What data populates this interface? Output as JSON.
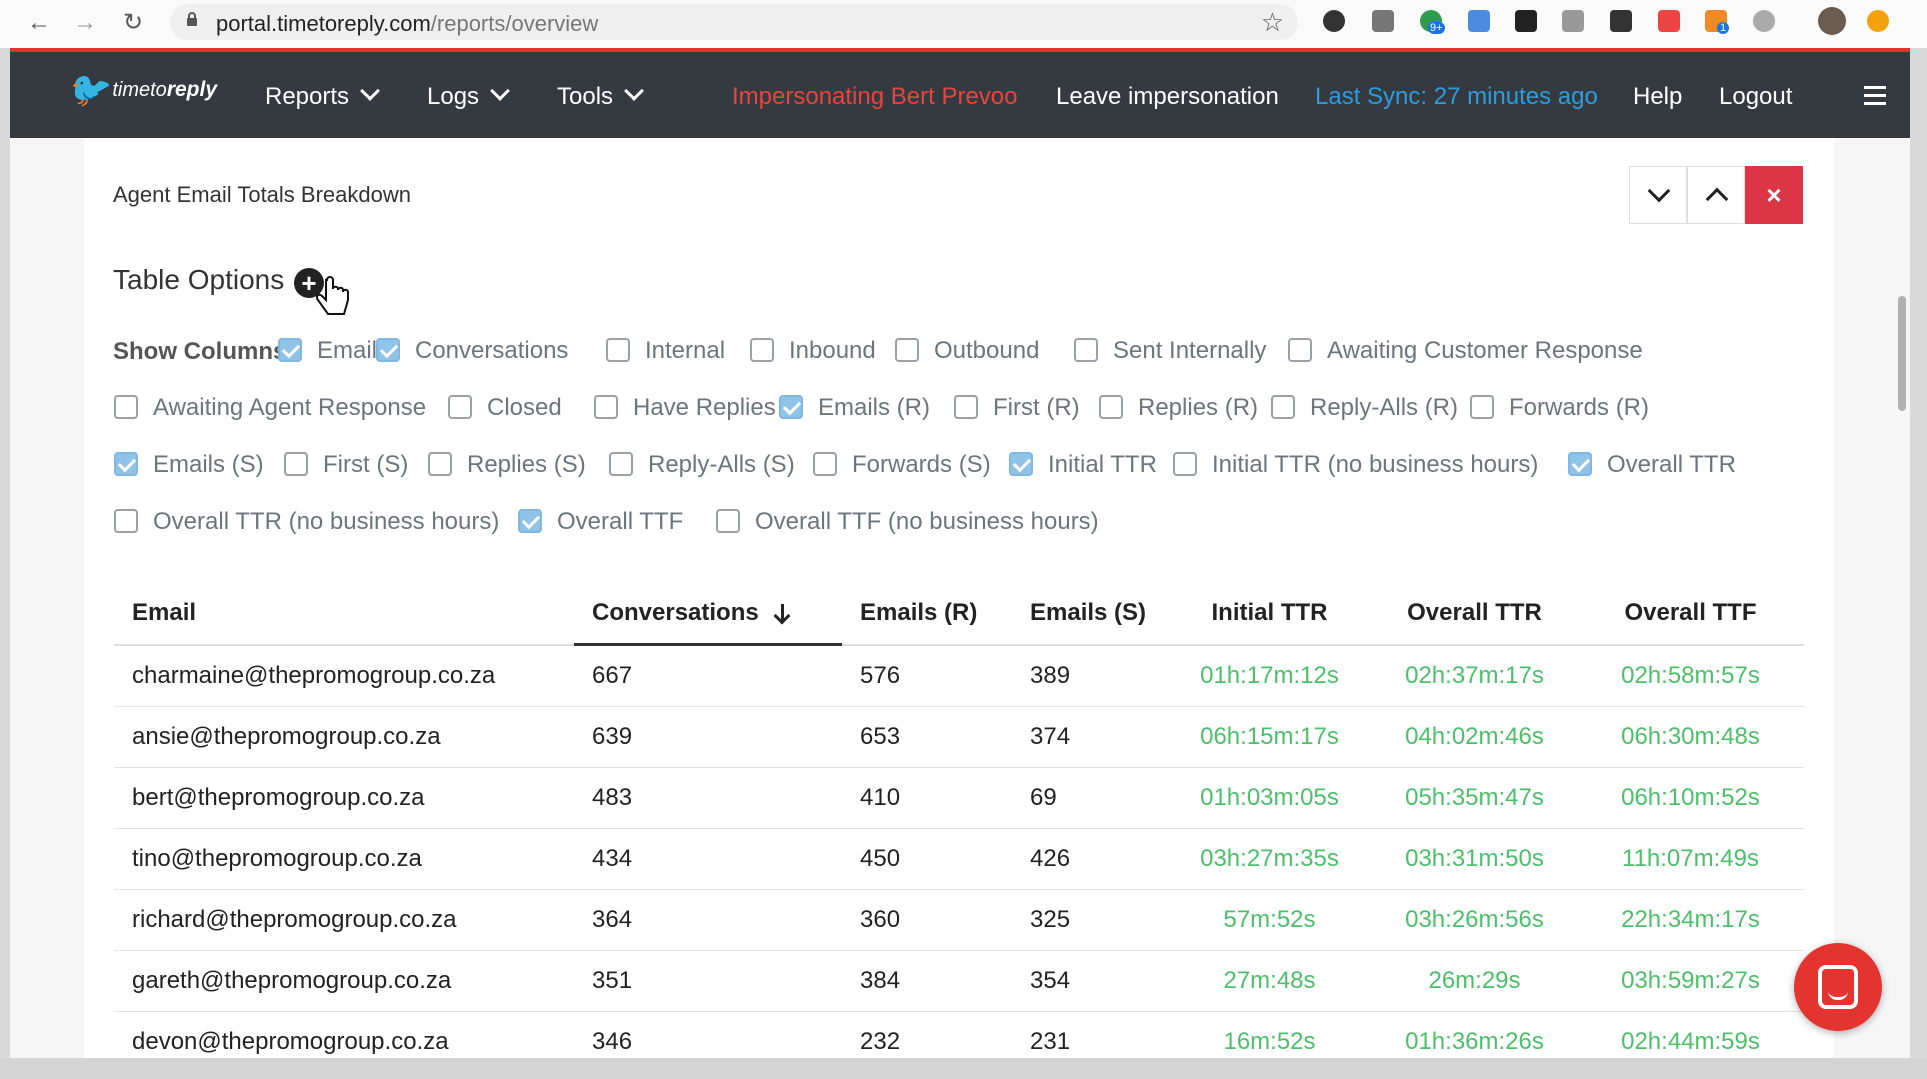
{
  "browser": {
    "url_host": "portal.timetoreply.com",
    "url_path": "/reports/overview",
    "back_icon": "arrow-left",
    "forward_icon": "arrow-right",
    "reload_icon": "reload",
    "star_icon": "star",
    "extension_badge_1": "9+",
    "extension_badge_2": "1"
  },
  "nav": {
    "logo_text_1": "timeto",
    "logo_text_2": "reply",
    "logo_mark": "🐦",
    "reports": "Reports",
    "logs": "Logs",
    "tools": "Tools",
    "impersonating": "Impersonating Bert Prevoo",
    "leave": "Leave impersonation",
    "last_sync": "Last Sync: 27 minutes ago",
    "help": "Help",
    "logout": "Logout",
    "colors": {
      "impersonating": "#e3463f",
      "last_sync": "#2e9cdc"
    }
  },
  "card": {
    "title": "Agent Email Totals Breakdown",
    "close_symbol": "×",
    "options_title": "Table Options",
    "plus_symbol": "+",
    "show_columns_label": "Show Columns",
    "columns": [
      {
        "label": "Email",
        "checked": true
      },
      {
        "label": "Conversations",
        "checked": true
      },
      {
        "label": "Internal",
        "checked": false
      },
      {
        "label": "Inbound",
        "checked": false
      },
      {
        "label": "Outbound",
        "checked": false
      },
      {
        "label": "Sent Internally",
        "checked": false
      },
      {
        "label": "Awaiting Customer Response",
        "checked": false
      },
      {
        "label": "Awaiting Agent Response",
        "checked": false
      },
      {
        "label": "Closed",
        "checked": false
      },
      {
        "label": "Have Replies",
        "checked": false
      },
      {
        "label": "Emails (R)",
        "checked": true
      },
      {
        "label": "First (R)",
        "checked": false
      },
      {
        "label": "Replies (R)",
        "checked": false
      },
      {
        "label": "Reply-Alls (R)",
        "checked": false
      },
      {
        "label": "Forwards (R)",
        "checked": false
      },
      {
        "label": "Emails (S)",
        "checked": true
      },
      {
        "label": "First (S)",
        "checked": false
      },
      {
        "label": "Replies (S)",
        "checked": false
      },
      {
        "label": "Reply-Alls (S)",
        "checked": false
      },
      {
        "label": "Forwards (S)",
        "checked": false
      },
      {
        "label": "Initial TTR",
        "checked": true
      },
      {
        "label": "Initial TTR (no business hours)",
        "checked": false
      },
      {
        "label": "Overall TTR",
        "checked": true
      },
      {
        "label": "Overall TTR (no business hours)",
        "checked": false
      },
      {
        "label": "Overall TTF",
        "checked": true
      },
      {
        "label": "Overall TTF (no business hours)",
        "checked": false
      }
    ]
  },
  "table": {
    "headers": [
      "Email",
      "Conversations",
      "Emails (R)",
      "Emails (S)",
      "Initial TTR",
      "Overall TTR",
      "Overall TTF"
    ],
    "sorted_column": "Conversations",
    "sort_direction": "desc",
    "time_color": "#4cbf6a",
    "rows": [
      [
        "charmaine@thepromogroup.co.za",
        "667",
        "576",
        "389",
        "01h:17m:12s",
        "02h:37m:17s",
        "02h:58m:57s"
      ],
      [
        "ansie@thepromogroup.co.za",
        "639",
        "653",
        "374",
        "06h:15m:17s",
        "04h:02m:46s",
        "06h:30m:48s"
      ],
      [
        "bert@thepromogroup.co.za",
        "483",
        "410",
        "69",
        "01h:03m:05s",
        "05h:35m:47s",
        "06h:10m:52s"
      ],
      [
        "tino@thepromogroup.co.za",
        "434",
        "450",
        "426",
        "03h:27m:35s",
        "03h:31m:50s",
        "11h:07m:49s"
      ],
      [
        "richard@thepromogroup.co.za",
        "364",
        "360",
        "325",
        "57m:52s",
        "03h:26m:56s",
        "22h:34m:17s"
      ],
      [
        "gareth@thepromogroup.co.za",
        "351",
        "384",
        "354",
        "27m:48s",
        "26m:29s",
        "03h:59m:27s"
      ],
      [
        "devon@thepromogroup.co.za",
        "346",
        "232",
        "231",
        "16m:52s",
        "01h:36m:26s",
        "02h:44m:59s"
      ]
    ]
  }
}
